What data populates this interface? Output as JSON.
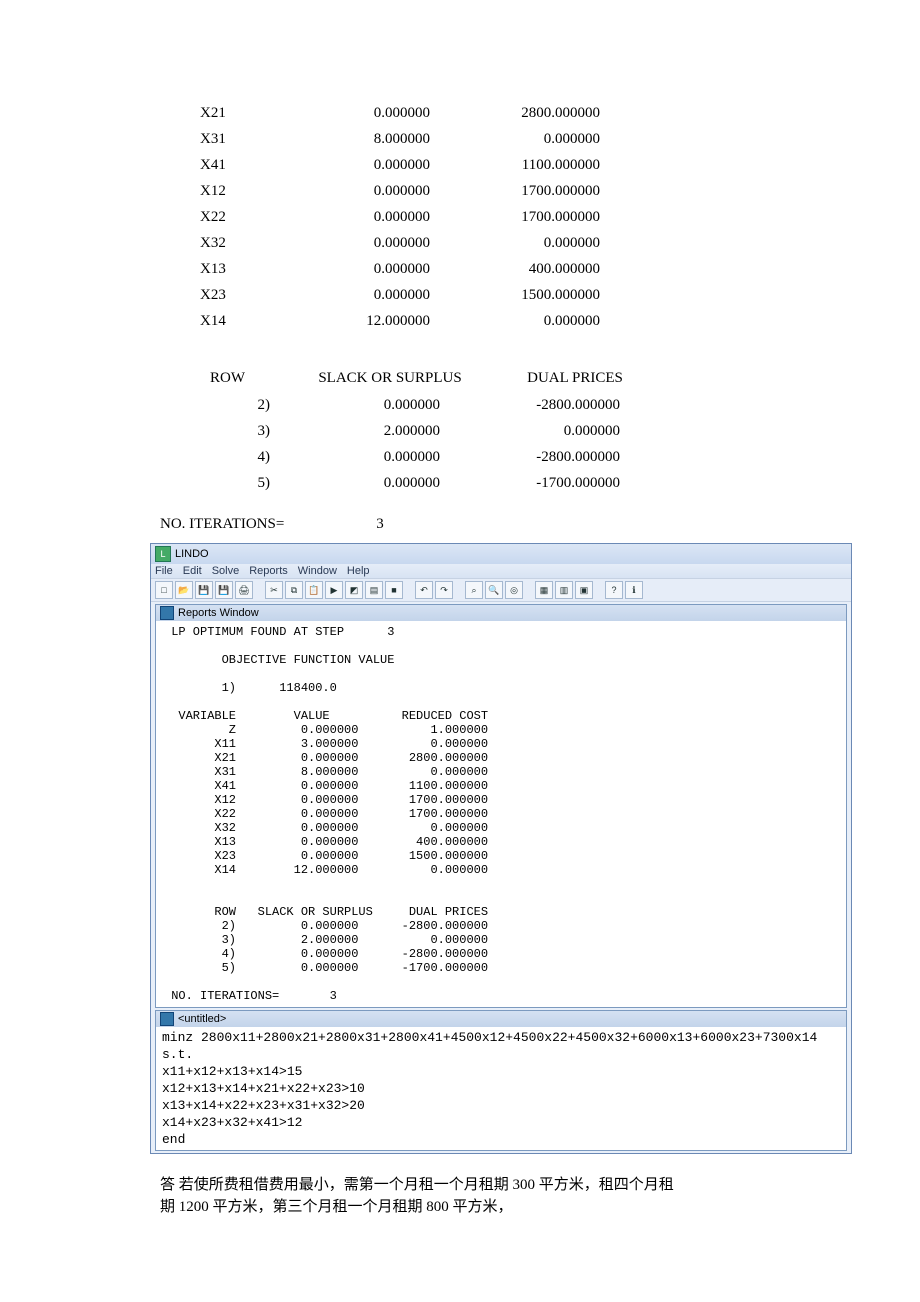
{
  "vars": [
    {
      "name": "X21",
      "value": "0.000000",
      "rc": "2800.000000"
    },
    {
      "name": "X31",
      "value": "8.000000",
      "rc": "0.000000"
    },
    {
      "name": "X41",
      "value": "0.000000",
      "rc": "1100.000000"
    },
    {
      "name": "X12",
      "value": "0.000000",
      "rc": "1700.000000"
    },
    {
      "name": "X22",
      "value": "0.000000",
      "rc": "1700.000000"
    },
    {
      "name": "X32",
      "value": "0.000000",
      "rc": "0.000000"
    },
    {
      "name": "X13",
      "value": "0.000000",
      "rc": "400.000000"
    },
    {
      "name": "X23",
      "value": "0.000000",
      "rc": "1500.000000"
    },
    {
      "name": "X14",
      "value": "12.000000",
      "rc": "0.000000"
    }
  ],
  "row_header": {
    "c1": "ROW",
    "c2": "SLACK OR SURPLUS",
    "c3": "DUAL PRICES"
  },
  "rows": [
    {
      "r": "2)",
      "s": "0.000000",
      "d": "-2800.000000"
    },
    {
      "r": "3)",
      "s": "2.000000",
      "d": "0.000000"
    },
    {
      "r": "4)",
      "s": "0.000000",
      "d": "-2800.000000"
    },
    {
      "r": "5)",
      "s": "0.000000",
      "d": "-1700.000000"
    }
  ],
  "iterations_label": "NO. ITERATIONS=",
  "iterations_value": "3",
  "lindo": {
    "title": "LINDO",
    "menu": [
      "File",
      "Edit",
      "Solve",
      "Reports",
      "Window",
      "Help"
    ],
    "reports_title": "Reports Window",
    "untitled_title": "<untitled>",
    "report": " LP OPTIMUM FOUND AT STEP      3\n\n        OBJECTIVE FUNCTION VALUE\n\n        1)      118400.0\n\n  VARIABLE        VALUE          REDUCED COST\n         Z         0.000000          1.000000\n       X11         3.000000          0.000000\n       X21         0.000000       2800.000000\n       X31         8.000000          0.000000\n       X41         0.000000       1100.000000\n       X12         0.000000       1700.000000\n       X22         0.000000       1700.000000\n       X32         0.000000          0.000000\n       X13         0.000000        400.000000\n       X23         0.000000       1500.000000\n       X14        12.000000          0.000000\n\n\n       ROW   SLACK OR SURPLUS     DUAL PRICES\n        2)         0.000000      -2800.000000\n        3)         2.000000          0.000000\n        4)         0.000000      -2800.000000\n        5)         0.000000      -1700.000000\n\n NO. ITERATIONS=       3",
    "model": "minz 2800x11+2800x21+2800x31+2800x41+4500x12+4500x22+4500x32+6000x13+6000x23+7300x14\ns.t.\nx11+x12+x13+x14>15\nx12+x13+x14+x21+x22+x23>10\nx13+x14+x22+x23+x31+x32>20\nx14+x23+x32+x41>12\nend"
  },
  "answer_lines": [
    "答  若使所费租借费用最小，需第一个月租一个月租期 300 平方米，租四个月租",
    "期 1200 平方米，第三个月租一个月租期 800 平方米，"
  ],
  "chart_data": {
    "type": "table",
    "title": "LINDO LP output",
    "objective": 118400.0,
    "iterations": 3,
    "variables": [
      {
        "name": "Z",
        "value": 0.0,
        "reduced_cost": 1.0
      },
      {
        "name": "X11",
        "value": 3.0,
        "reduced_cost": 0.0
      },
      {
        "name": "X21",
        "value": 0.0,
        "reduced_cost": 2800.0
      },
      {
        "name": "X31",
        "value": 8.0,
        "reduced_cost": 0.0
      },
      {
        "name": "X41",
        "value": 0.0,
        "reduced_cost": 1100.0
      },
      {
        "name": "X12",
        "value": 0.0,
        "reduced_cost": 1700.0
      },
      {
        "name": "X22",
        "value": 0.0,
        "reduced_cost": 1700.0
      },
      {
        "name": "X32",
        "value": 0.0,
        "reduced_cost": 0.0
      },
      {
        "name": "X13",
        "value": 0.0,
        "reduced_cost": 400.0
      },
      {
        "name": "X23",
        "value": 0.0,
        "reduced_cost": 1500.0
      },
      {
        "name": "X14",
        "value": 12.0,
        "reduced_cost": 0.0
      }
    ],
    "constraints": [
      {
        "row": 2,
        "slack_or_surplus": 0.0,
        "dual_price": -2800.0
      },
      {
        "row": 3,
        "slack_or_surplus": 2.0,
        "dual_price": 0.0
      },
      {
        "row": 4,
        "slack_or_surplus": 0.0,
        "dual_price": -2800.0
      },
      {
        "row": 5,
        "slack_or_surplus": 0.0,
        "dual_price": -1700.0
      }
    ]
  }
}
